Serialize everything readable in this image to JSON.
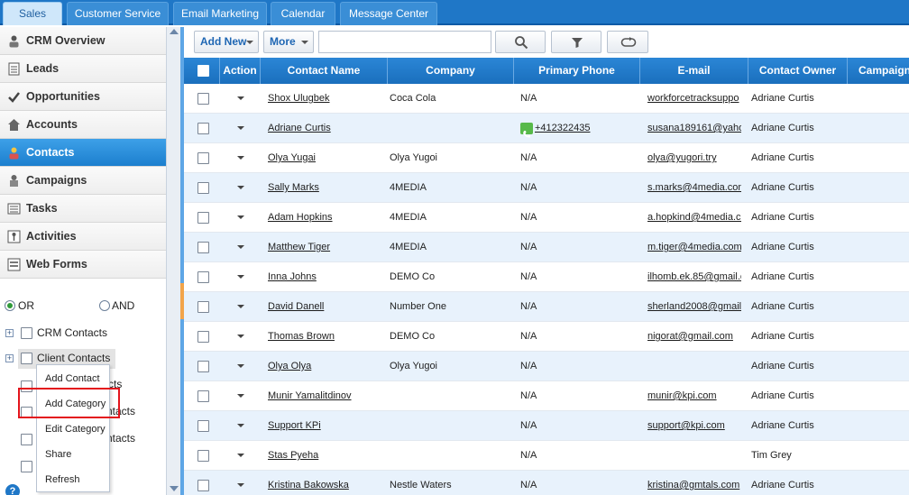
{
  "top_tabs": [
    {
      "label": "Sales",
      "active": true
    },
    {
      "label": "Customer Service",
      "active": false
    },
    {
      "label": "Email Marketing",
      "active": false
    },
    {
      "label": "Calendar",
      "active": false
    },
    {
      "label": "Message Center",
      "active": false
    }
  ],
  "sidebar": {
    "items": [
      {
        "label": "CRM Overview",
        "icon": "person-chart-icon"
      },
      {
        "label": "Leads",
        "icon": "leads-list-icon"
      },
      {
        "label": "Opportunities",
        "icon": "check-mark-icon"
      },
      {
        "label": "Accounts",
        "icon": "home-icon"
      },
      {
        "label": "Contacts",
        "icon": "contact-person-icon",
        "active": true
      },
      {
        "label": "Campaigns",
        "icon": "megaphone-icon"
      },
      {
        "label": "Tasks",
        "icon": "tasks-list-icon"
      },
      {
        "label": "Activities",
        "icon": "activities-icon"
      },
      {
        "label": "Web Forms",
        "icon": "web-form-icon"
      }
    ],
    "filter": {
      "or_label": "OR",
      "and_label": "AND",
      "selected": "OR"
    },
    "categories": [
      {
        "label": "CRM Contacts"
      },
      {
        "label": "Client Contacts"
      }
    ],
    "hidden_fragments": [
      "cts",
      "ntacts",
      "ntacts"
    ]
  },
  "context_menu": {
    "items": [
      "Add Contact",
      "Add Category",
      "Edit Category",
      "Share",
      "Refresh"
    ],
    "highlighted": "Add Category"
  },
  "help": {
    "label": "?"
  },
  "toolbar": {
    "add_new_label": "Add New",
    "more_label": "More",
    "search_value": "",
    "icons": {
      "search": "search-icon",
      "filter": "filter-icon",
      "refresh": "refresh-icon"
    }
  },
  "grid": {
    "columns": [
      "",
      "Action",
      "Contact Name",
      "Company",
      "Primary Phone",
      "E-mail",
      "Contact Owner",
      "Campaign"
    ],
    "rows": [
      {
        "name": "Shox Ulugbek",
        "company": "Coca Cola",
        "phone": "N/A",
        "email": "workforcetracksuppo",
        "owner": "Adriane Curtis"
      },
      {
        "name": "Adriane Curtis",
        "company": "",
        "phone": "+412322435",
        "phone_icon": true,
        "email": "susana189161@yaho",
        "owner": "Adriane Curtis"
      },
      {
        "name": "Olya Yugai",
        "company": "Olya Yugoi",
        "phone": "N/A",
        "email": "olya@yugori.try",
        "owner": "Adriane Curtis"
      },
      {
        "name": "Sally Marks",
        "company": "4MEDIA",
        "phone": "N/A",
        "email": "s.marks@4media.com",
        "owner": "Adriane Curtis"
      },
      {
        "name": "Adam Hopkins",
        "company": "4MEDIA",
        "phone": "N/A",
        "email": "a.hopkind@4media.co",
        "owner": "Adriane Curtis"
      },
      {
        "name": "Matthew Tiger",
        "company": "4MEDIA",
        "phone": "N/A",
        "email": "m.tiger@4media.com",
        "owner": "Adriane Curtis"
      },
      {
        "name": "Inna Johns",
        "company": "DEMO Co",
        "phone": "N/A",
        "email": "ilhomb.ek.85@gmail.c",
        "owner": "Adriane Curtis"
      },
      {
        "name": "David Danell",
        "company": "Number One",
        "phone": "N/A",
        "email": "sherland2008@gmail.",
        "owner": "Adriane Curtis"
      },
      {
        "name": "Thomas Brown",
        "company": "DEMO Co",
        "phone": "N/A",
        "email": "nigorat@gmail.com",
        "owner": "Adriane Curtis"
      },
      {
        "name": "Olya Olya",
        "company": "Olya Yugoi",
        "phone": "N/A",
        "email": "",
        "owner": "Adriane Curtis"
      },
      {
        "name": "Munir Yamalitdinov",
        "company": "",
        "phone": "N/A",
        "email": "munir@kpi.com",
        "owner": "Adriane Curtis"
      },
      {
        "name": "Support KPi",
        "company": "",
        "phone": "N/A",
        "email": "support@kpi.com",
        "owner": "Adriane Curtis"
      },
      {
        "name": "Stas Pyeha",
        "company": "",
        "phone": "N/A",
        "email": "",
        "owner": "Tim Grey"
      },
      {
        "name": "Kristina Bakowska",
        "company": "Nestle Waters",
        "phone": "N/A",
        "email": "kristina@gmtals.com",
        "owner": "Adriane Curtis"
      }
    ]
  }
}
